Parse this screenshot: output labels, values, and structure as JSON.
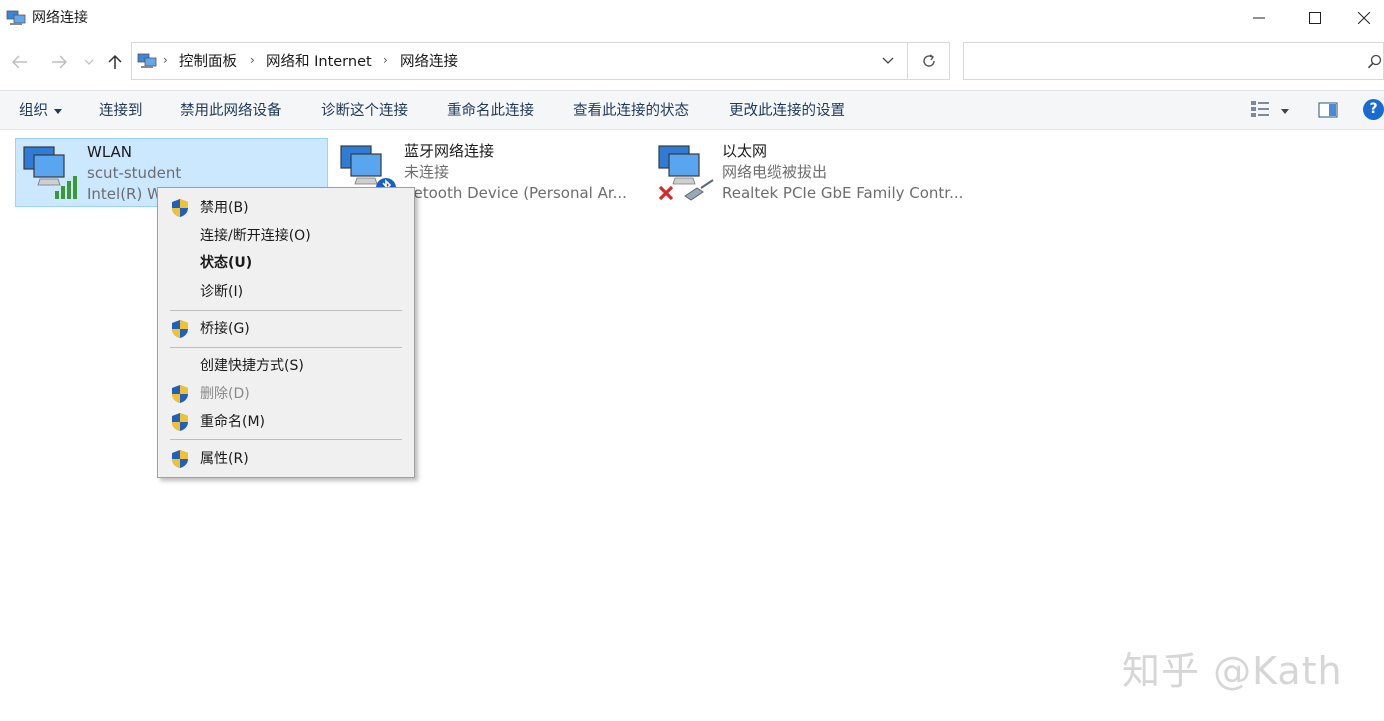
{
  "window": {
    "title": "网络连接"
  },
  "address": {
    "breadcrumbs": [
      "控制面板",
      "网络和 Internet",
      "网络连接"
    ]
  },
  "search": {
    "placeholder": "",
    "value": ""
  },
  "toolbar": {
    "organize": "组织",
    "connect_to": "连接到",
    "disable_device": "禁用此网络设备",
    "diagnose": "诊断这个连接",
    "rename": "重命名此连接",
    "view_status": "查看此连接的状态",
    "change_settings": "更改此连接的设置"
  },
  "connections": [
    {
      "name": "WLAN",
      "status": "scut-student",
      "device": "Intel(R) Wi",
      "selected": true,
      "icon": "wifi-signal-icon"
    },
    {
      "name": "蓝牙网络连接",
      "status": "未连接",
      "device": "uetooth Device (Personal Ar...",
      "selected": false,
      "icon": "bluetooth-icon"
    },
    {
      "name": "以太网",
      "status": "网络电缆被拔出",
      "device": "Realtek PCIe GbE Family Contr...",
      "selected": false,
      "icon": "cable-unplugged-icon"
    }
  ],
  "context_menu": {
    "items": [
      {
        "label": "禁用(B)",
        "shield": true,
        "bold": false,
        "disabled": false
      },
      {
        "label": "连接/断开连接(O)",
        "shield": false,
        "bold": false,
        "disabled": false
      },
      {
        "label": "状态(U)",
        "shield": false,
        "bold": true,
        "disabled": false
      },
      {
        "label": "诊断(I)",
        "shield": false,
        "bold": false,
        "disabled": false
      },
      {
        "label": "桥接(G)",
        "shield": true,
        "bold": false,
        "disabled": false
      },
      {
        "label": "创建快捷方式(S)",
        "shield": false,
        "bold": false,
        "disabled": false
      },
      {
        "label": "删除(D)",
        "shield": true,
        "bold": false,
        "disabled": true
      },
      {
        "label": "重命名(M)",
        "shield": true,
        "bold": false,
        "disabled": false
      },
      {
        "label": "属性(R)",
        "shield": true,
        "bold": false,
        "disabled": false
      }
    ]
  },
  "watermark": "知乎 @Kath",
  "colors": {
    "selection": "#cce8ff",
    "command_text": "#1e395b",
    "help": "#1a6bd1"
  }
}
